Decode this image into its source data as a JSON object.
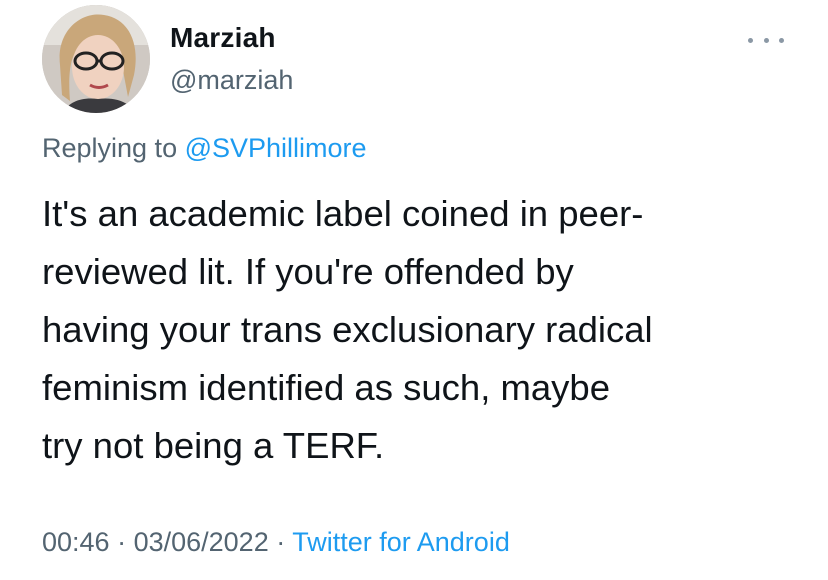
{
  "author": {
    "display_name": "Marziah",
    "handle": "@marziah"
  },
  "more_icon": "more-horizontal-icon",
  "reply": {
    "prefix": "Replying to ",
    "mention": "@SVPhillimore"
  },
  "tweet": {
    "lines": [
      "It's an academic label coined in peer-",
      "reviewed lit. If you're offended by",
      "having your trans exclusionary radical",
      "feminism identified as such, maybe",
      "try not being a TERF."
    ]
  },
  "meta": {
    "time": "00:46",
    "separator": " · ",
    "date": "03/06/2022",
    "source": "Twitter for Android"
  },
  "colors": {
    "text": "#0f1419",
    "secondary": "#536471",
    "link": "#1d9bf0"
  }
}
